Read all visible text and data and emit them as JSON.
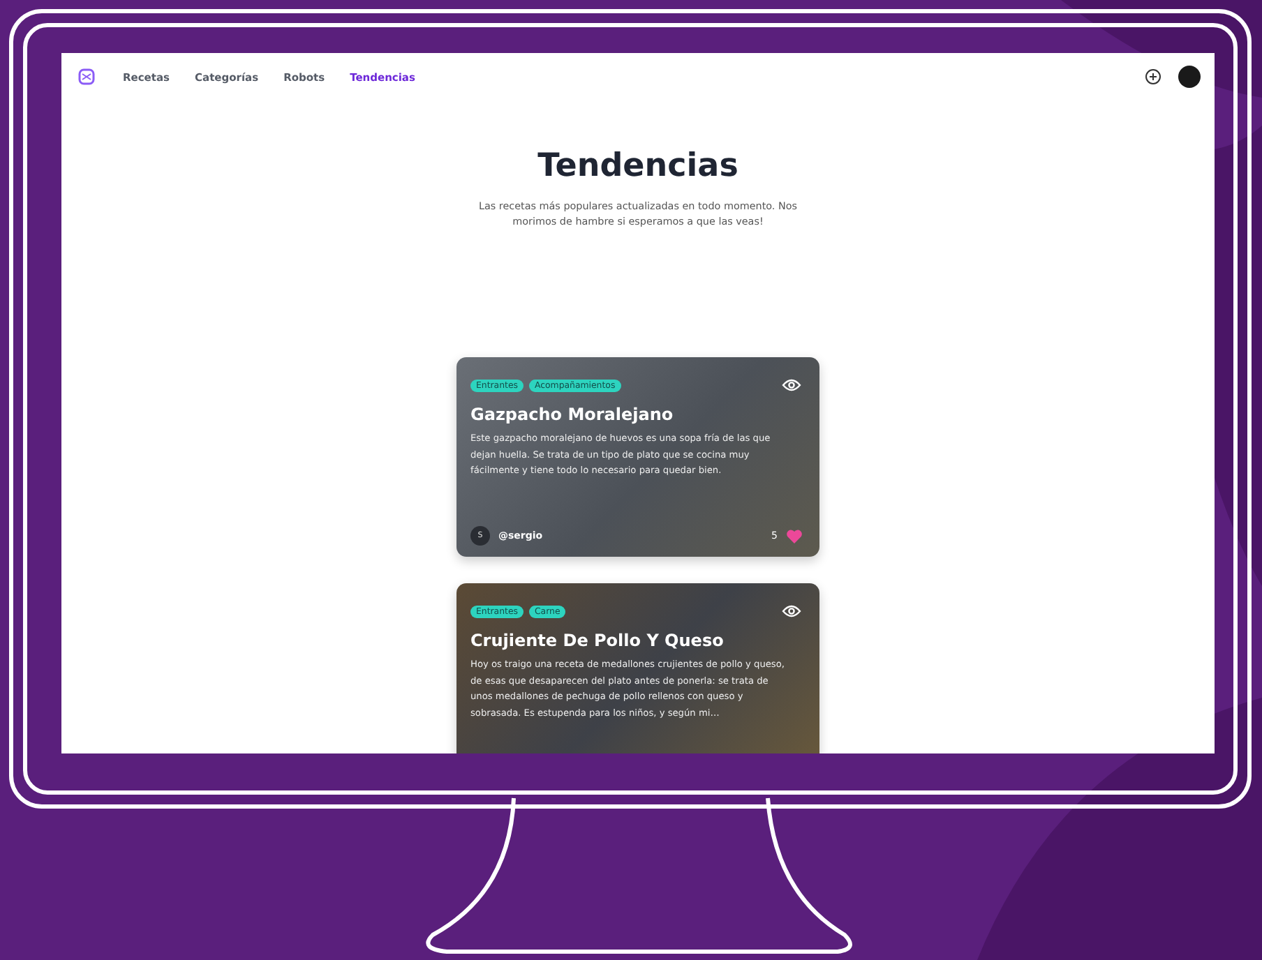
{
  "nav": {
    "items": [
      {
        "label": "Recetas",
        "selected": false
      },
      {
        "label": "Categorías",
        "selected": false
      },
      {
        "label": "Robots",
        "selected": false
      },
      {
        "label": "Tendencias",
        "selected": true
      }
    ]
  },
  "header": {
    "title": "Tendencias",
    "subtitle": "Las recetas más populares actualizadas en todo momento. Nos morimos de hambre si esperamos a que las veas!"
  },
  "recipes": [
    {
      "tags": [
        "Entrantes",
        "Acompañamientos"
      ],
      "title": "Gazpacho Moralejano",
      "description": "Este gazpacho moralejano de huevos es una sopa fría de las que dejan huella. Se trata de un tipo de plato que se cocina muy fácilmente y tiene todo lo necesario para quedar bien.",
      "author_initial": "S",
      "author": "@sergio",
      "likes": "5"
    },
    {
      "tags": [
        "Entrantes",
        "Carne"
      ],
      "title": "Crujiente De Pollo Y Queso",
      "description": "Hoy os traigo una receta de medallones crujientes de pollo y queso, de esas que desaparecen del plato antes de ponerla: se trata de unos medallones de pechuga de pollo rellenos con queso y sobrasada. Es estupenda para los niños, y según mi…"
    }
  ]
}
